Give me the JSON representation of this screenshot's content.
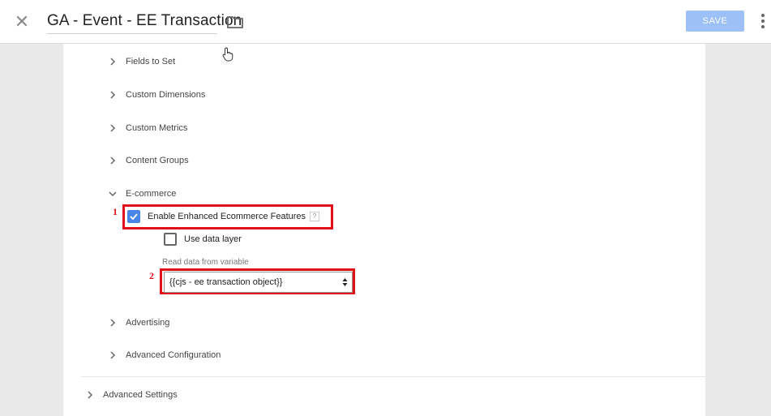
{
  "header": {
    "title": "GA - Event - EE Transaction",
    "save_label": "SAVE"
  },
  "sections": [
    {
      "label": "Fields to Set"
    },
    {
      "label": "Custom Dimensions"
    },
    {
      "label": "Custom Metrics"
    },
    {
      "label": "Content Groups"
    },
    {
      "label": "E-commerce"
    },
    {
      "label": "Advertising"
    },
    {
      "label": "Advanced Configuration"
    }
  ],
  "ecommerce": {
    "enable_label": "Enable Enhanced Ecommerce Features",
    "enable_checked": true,
    "help_glyph": "?",
    "use_data_layer_label": "Use data layer",
    "use_data_layer_checked": false,
    "read_label": "Read data from variable",
    "variable_value": "{{cjs - ee transaction object}}"
  },
  "annotations": {
    "first": "1",
    "second": "2",
    "color": "#e2101a"
  },
  "advanced_settings_label": "Advanced Settings",
  "colors": {
    "accent": "#4a86e8",
    "save_button": "#9dc0f7"
  }
}
